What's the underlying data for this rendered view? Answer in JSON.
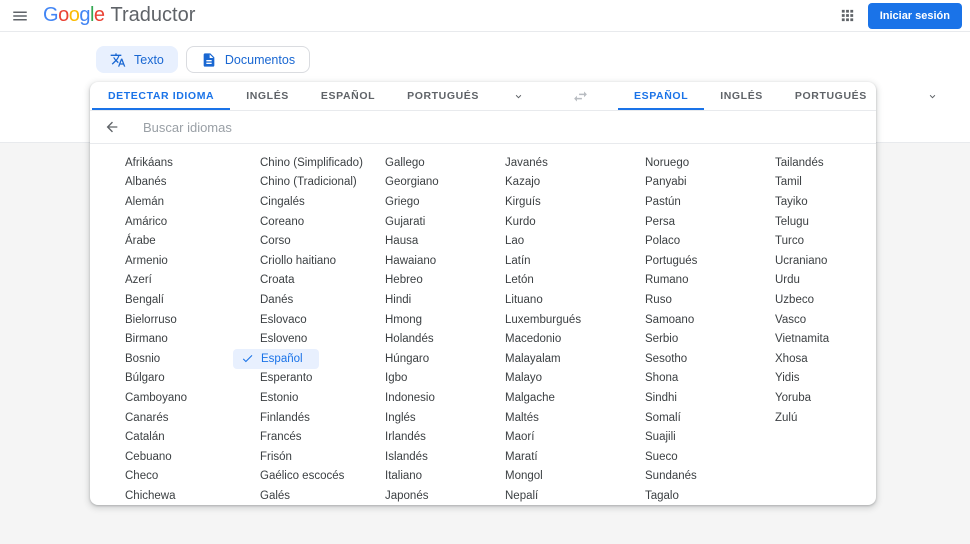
{
  "header": {
    "logo_letters": [
      {
        "ch": "G",
        "color": "#4285F4"
      },
      {
        "ch": "o",
        "color": "#EA4335"
      },
      {
        "ch": "o",
        "color": "#FBBC05"
      },
      {
        "ch": "g",
        "color": "#4285F4"
      },
      {
        "ch": "l",
        "color": "#34A853"
      },
      {
        "ch": "e",
        "color": "#EA4335"
      }
    ],
    "app_name": "Traductor",
    "sign_in_label": "Iniciar sesión"
  },
  "toolbar": {
    "text_tab": "Texto",
    "documents_tab": "Documentos"
  },
  "language_bar": {
    "source_tabs": [
      {
        "label": "DETECTAR IDIOMA",
        "active": true
      },
      {
        "label": "INGLÉS",
        "active": false
      },
      {
        "label": "ESPAÑOL",
        "active": false
      },
      {
        "label": "PORTUGUÉS",
        "active": false
      }
    ],
    "target_tabs": [
      {
        "label": "ESPAÑOL",
        "active": true
      },
      {
        "label": "INGLÉS",
        "active": false
      },
      {
        "label": "PORTUGUÉS",
        "active": false
      }
    ]
  },
  "search": {
    "placeholder": "Buscar idiomas"
  },
  "language_list": {
    "selected": "Español",
    "columns": [
      [
        "Afrikáans",
        "Albanés",
        "Alemán",
        "Amárico",
        "Árabe",
        "Armenio",
        "Azerí",
        "Bengalí",
        "Bielorruso",
        "Birmano",
        "Bosnio",
        "Búlgaro",
        "Camboyano",
        "Canarés",
        "Catalán",
        "Cebuano",
        "Checo",
        "Chichewa"
      ],
      [
        "Chino (Simplificado)",
        "Chino (Tradicional)",
        "Cingalés",
        "Coreano",
        "Corso",
        "Criollo haitiano",
        "Croata",
        "Danés",
        "Eslovaco",
        "Esloveno",
        "Español",
        "Esperanto",
        "Estonio",
        "Finlandés",
        "Francés",
        "Frisón",
        "Gaélico escocés",
        "Galés"
      ],
      [
        "Gallego",
        "Georgiano",
        "Griego",
        "Gujarati",
        "Hausa",
        "Hawaiano",
        "Hebreo",
        "Hindi",
        "Hmong",
        "Holandés",
        "Húngaro",
        "Igbo",
        "Indonesio",
        "Inglés",
        "Irlandés",
        "Islandés",
        "Italiano",
        "Japonés"
      ],
      [
        "Javanés",
        "Kazajo",
        "Kirguís",
        "Kurdo",
        "Lao",
        "Latín",
        "Letón",
        "Lituano",
        "Luxemburgués",
        "Macedonio",
        "Malayalam",
        "Malayo",
        "Malgache",
        "Maltés",
        "Maorí",
        "Maratí",
        "Mongol",
        "Nepalí"
      ],
      [
        "Noruego",
        "Panyabi",
        "Pastún",
        "Persa",
        "Polaco",
        "Portugués",
        "Rumano",
        "Ruso",
        "Samoano",
        "Serbio",
        "Sesotho",
        "Shona",
        "Sindhi",
        "Somalí",
        "Suajili",
        "Sueco",
        "Sundanés",
        "Tagalo"
      ],
      [
        "Tailandés",
        "Tamil",
        "Tayiko",
        "Telugu",
        "Turco",
        "Ucraniano",
        "Urdu",
        "Uzbeco",
        "Vasco",
        "Vietnamita",
        "Xhosa",
        "Yidis",
        "Yoruba",
        "Zulú"
      ]
    ]
  },
  "colors": {
    "accent_blue": "#1a73e8",
    "selected_bg": "#e8f0fe",
    "chip_text": "#1967d2",
    "inactive_tab": "#5f6368",
    "page_bg": "#f5f5f5"
  }
}
